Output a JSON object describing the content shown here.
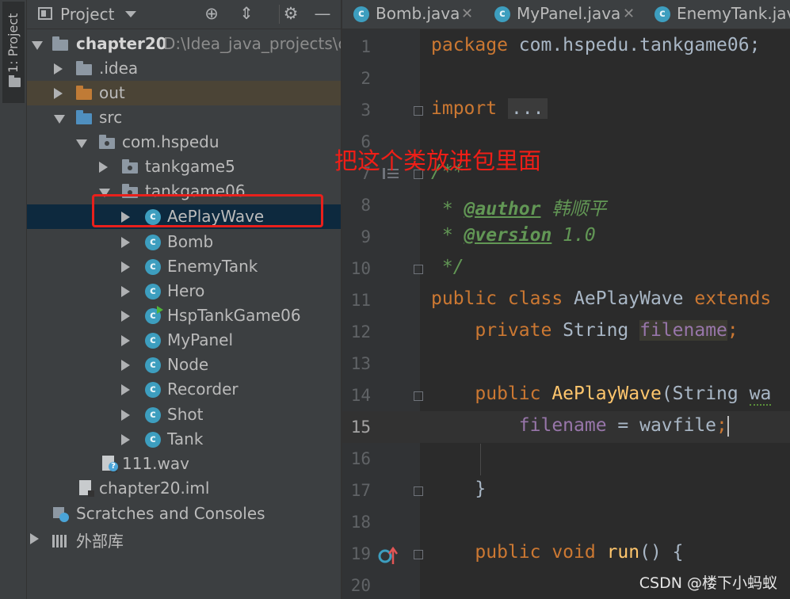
{
  "sidebar_stripe": {
    "label": "1: Project"
  },
  "project_panel": {
    "title": "Project",
    "tree": [
      {
        "label": "chapter20",
        "path": "D:\\Idea_java_projects\\ch"
      },
      {
        "label": ".idea"
      },
      {
        "label": "out"
      },
      {
        "label": "src"
      },
      {
        "label": "com.hspedu"
      },
      {
        "label": "tankgame5"
      },
      {
        "label": "tankgame06"
      },
      {
        "label": "AePlayWave"
      },
      {
        "label": "Bomb"
      },
      {
        "label": "EnemyTank"
      },
      {
        "label": "Hero"
      },
      {
        "label": "HspTankGame06"
      },
      {
        "label": "MyPanel"
      },
      {
        "label": "Node"
      },
      {
        "label": "Recorder"
      },
      {
        "label": "Shot"
      },
      {
        "label": "Tank"
      },
      {
        "label": "111.wav"
      },
      {
        "label": "chapter20.iml"
      },
      {
        "label": "Scratches and Consoles"
      },
      {
        "label": "外部库"
      }
    ]
  },
  "editor": {
    "tabs": [
      {
        "label": "Bomb.java"
      },
      {
        "label": "MyPanel.java"
      },
      {
        "label": "EnemyTank.java"
      }
    ],
    "current_line": "15",
    "line_numbers": [
      "1",
      "2",
      "3",
      "6",
      "7",
      "8",
      "9",
      "10",
      "11",
      "12",
      "13",
      "14",
      "15",
      "16",
      "17",
      "18",
      "19",
      "20"
    ],
    "code": {
      "l1_kw": "package",
      "l1_rest": " com.hspedu.tankgame06;",
      "l3_kw": "import",
      "l3_fold": "...",
      "l7": "/**",
      "l8_star": " * ",
      "l8_tag": "@author",
      "l8_val": " 韩顺平",
      "l9_star": " * ",
      "l9_tag": "@version",
      "l9_val": " 1.0",
      "l10": " */",
      "l11_kw1": "public class",
      "l11_name": " AePlayWave ",
      "l11_kw2": "extends",
      "l12_kw": "    private",
      "l12_type": " String ",
      "l12_field": "filename",
      "l12_semi": ";",
      "l14_kw": "    public",
      "l14_fn": " AePlayWave",
      "l14_rest": "(String ",
      "l14_param": "wa",
      "l15_field": "        filename",
      "l15_rest": " = wavfile",
      "l15_semi": ";",
      "l17": "    }",
      "l19_kw": "    public void",
      "l19_fn": " run",
      "l19_rest": "() {"
    }
  },
  "annotation": "把这个类放进包里面",
  "watermark": "CSDN @楼下小蚂蚁",
  "colors": {
    "annotation_red": "#e8201c",
    "selection": "#0d293e",
    "accent_class_icon": "#3d9ebf"
  }
}
